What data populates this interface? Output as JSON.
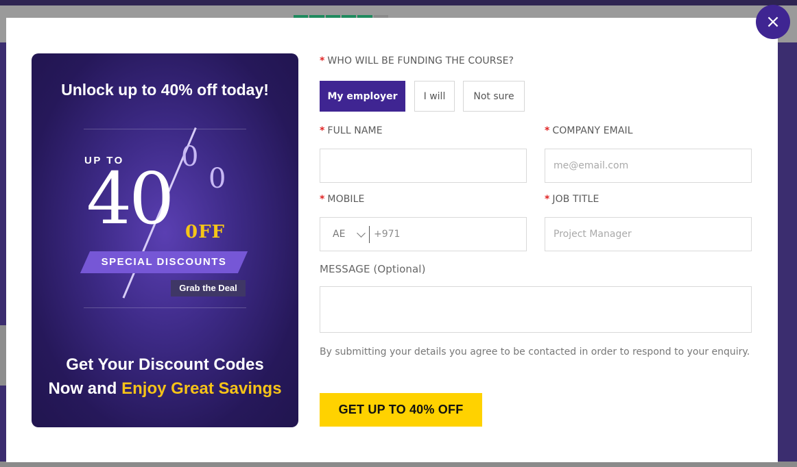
{
  "modal": {
    "close_label": "×"
  },
  "promo": {
    "headline": "Unlock up to 40% off today!",
    "up_to": "UP TO",
    "big_number": "40",
    "percent_top": "0",
    "percent_bottom": "0",
    "off_label": "0FF",
    "banner": "SPECIAL DISCOUNTS",
    "grab": "Grab the Deal",
    "footer_line1": "Get Your Discount Codes",
    "footer_line2_start": "Now and ",
    "footer_line2_highlight": "Enjoy Great Savings"
  },
  "form": {
    "required_mark": "*",
    "funding": {
      "label": "WHO WILL BE FUNDING THE COURSE?",
      "options": [
        "My employer",
        "I will",
        "Not sure"
      ],
      "selected": "My employer"
    },
    "full_name": {
      "label": "FULL NAME",
      "placeholder": "",
      "value": ""
    },
    "company_email": {
      "label": "COMPANY EMAIL",
      "placeholder": "me@email.com"
    },
    "mobile": {
      "label": "MOBILE",
      "country_code": "AE",
      "placeholder": "+971"
    },
    "job_title": {
      "label": "JOB TITLE",
      "placeholder": "Project Manager"
    },
    "message": {
      "label": "MESSAGE (Optional)",
      "placeholder": ""
    },
    "consent": "By submitting your details you agree to be contacted in order to respond to your enquiry.",
    "submit_label": "GET UP TO 40% OFF"
  },
  "colors": {
    "accent_purple": "#3f2592",
    "cta_yellow": "#ffd200",
    "highlight_yellow": "#f6c318",
    "required_red": "#e02424"
  }
}
